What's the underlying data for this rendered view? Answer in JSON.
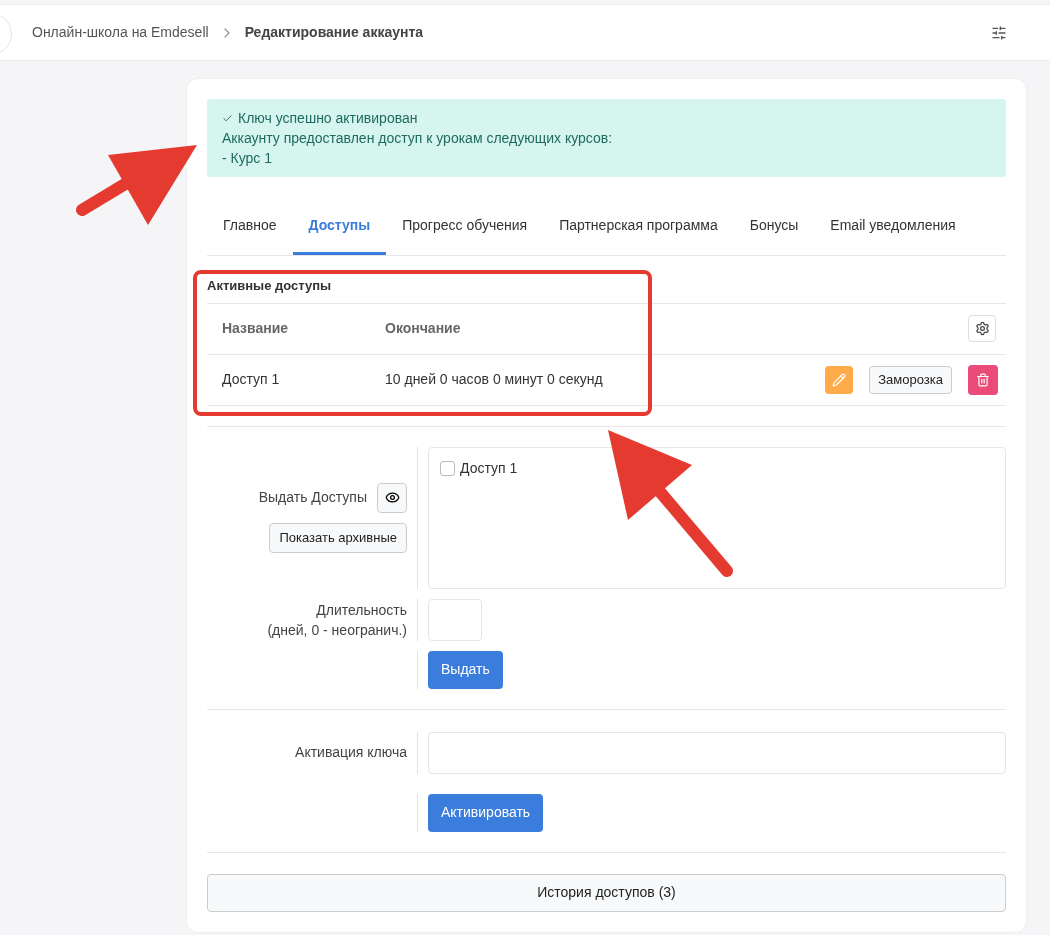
{
  "breadcrumb": {
    "items": [
      "Онлайн-школа на Emdesell",
      "Редактирование аккаунта"
    ]
  },
  "alert": {
    "title": "Ключ успешно активирован",
    "lines": [
      "Аккаунту предоставлен доступ к урокам следующих курсов:",
      "- Курс 1"
    ]
  },
  "tabs": [
    {
      "label": "Главное",
      "selected": false
    },
    {
      "label": "Доступы",
      "selected": true
    },
    {
      "label": "Прогресс обучения",
      "selected": false
    },
    {
      "label": "Партнерская программа",
      "selected": false
    },
    {
      "label": "Бонусы",
      "selected": false
    },
    {
      "label": "Email уведомления",
      "selected": false
    }
  ],
  "active_access": {
    "title": "Активные доступы",
    "columns": [
      "Название",
      "Окончание"
    ],
    "rows": [
      {
        "name": "Доступ 1",
        "ends": "10 дней 0 часов 0 минут 0 секунд",
        "freeze_label": "Заморозка"
      }
    ]
  },
  "grant": {
    "label": "Выдать Доступы",
    "archive_button": "Показать архивные",
    "options": [
      {
        "label": "Доступ 1",
        "checked": false
      }
    ],
    "duration_label": [
      "Длительность",
      "(дней, 0 - неогранич.)"
    ],
    "submit": "Выдать"
  },
  "key": {
    "label": "Активация ключа",
    "submit": "Активировать"
  },
  "history_button": "История доступов (3)"
}
